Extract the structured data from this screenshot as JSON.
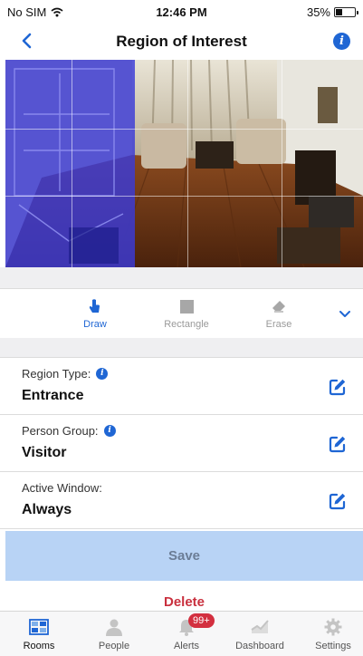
{
  "status_bar": {
    "carrier": "No SIM",
    "time": "12:46 PM",
    "battery": "35%",
    "battery_level": 0.35
  },
  "nav": {
    "title": "Region of Interest"
  },
  "toolbar": {
    "tools": [
      {
        "label": "Draw",
        "icon": "hand-pointer-icon",
        "active": true
      },
      {
        "label": "Rectangle",
        "icon": "square-icon",
        "active": false
      },
      {
        "label": "Erase",
        "icon": "eraser-icon",
        "active": false
      }
    ]
  },
  "settings": {
    "region_type": {
      "label": "Region Type:",
      "value": "Entrance"
    },
    "person_group": {
      "label": "Person Group:",
      "value": "Visitor"
    },
    "active_window": {
      "label": "Active Window:",
      "value": "Always"
    }
  },
  "actions": {
    "save": "Save",
    "delete": "Delete"
  },
  "tab_bar": {
    "items": [
      {
        "label": "Rooms",
        "icon": "rooms-icon",
        "active": true
      },
      {
        "label": "People",
        "icon": "person-icon",
        "active": false
      },
      {
        "label": "Alerts",
        "icon": "bell-icon",
        "active": false,
        "badge": "99+"
      },
      {
        "label": "Dashboard",
        "icon": "chart-icon",
        "active": false
      },
      {
        "label": "Settings",
        "icon": "gear-icon",
        "active": false
      }
    ]
  },
  "colors": {
    "accent": "#1f66d4",
    "save_bg": "#b8d3f5",
    "delete": "#c9303e",
    "badge": "#d32f3f",
    "region_overlay": "#3a3ad8"
  }
}
